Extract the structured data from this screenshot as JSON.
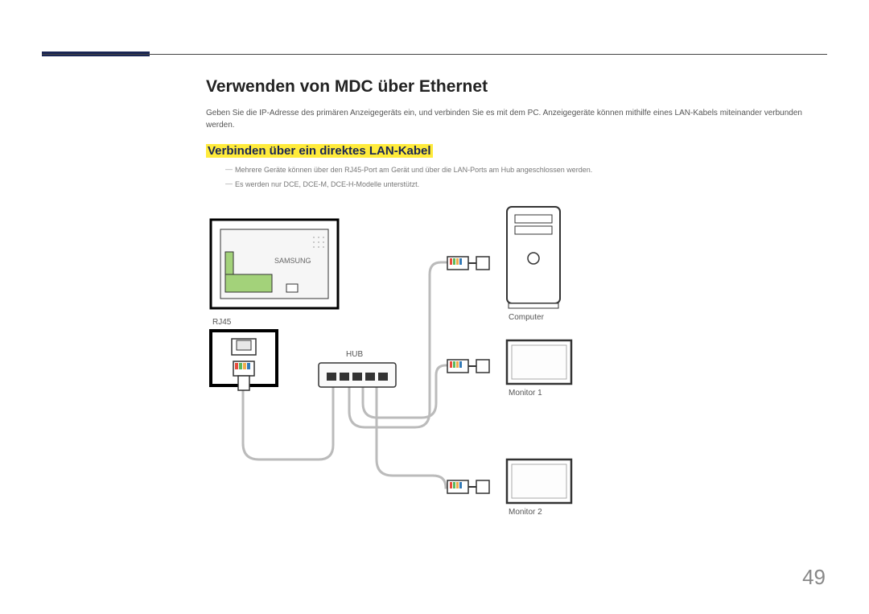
{
  "page_number": "49",
  "heading": "Verwenden von MDC über Ethernet",
  "intro": "Geben Sie die IP-Adresse des primären Anzeigegeräts ein, und verbinden Sie es mit dem PC. Anzeigegeräte können mithilfe eines LAN-Kabels miteinander verbunden werden.",
  "subheading": "Verbinden über ein direktes LAN-Kabel",
  "notes": [
    "Mehrere Geräte können über den RJ45-Port am Gerät und über die LAN-Ports am Hub angeschlossen werden.",
    "Es werden nur DCE, DCE-M, DCE-H-Modelle unterstützt."
  ],
  "diagram_labels": {
    "device_brand": "SAMSUNG",
    "rj45": "RJ45",
    "hub": "HUB",
    "computer": "Computer",
    "monitor1": "Monitor 1",
    "monitor2": "Monitor 2"
  }
}
